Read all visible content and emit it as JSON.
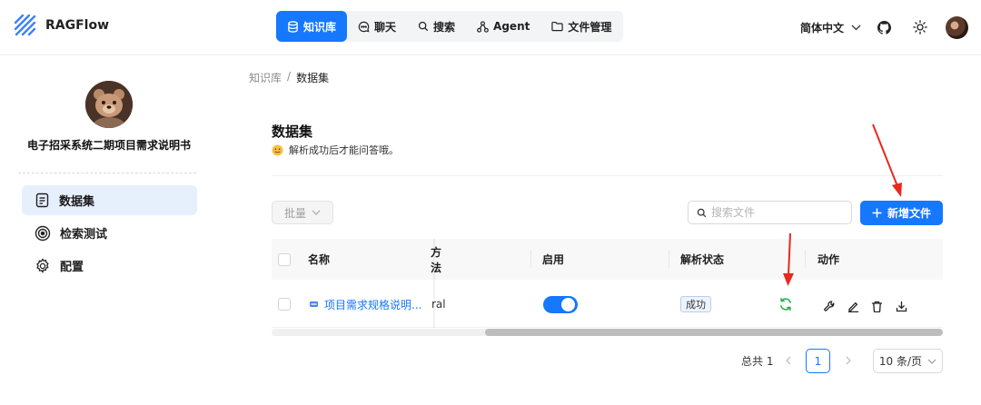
{
  "app": {
    "name": "RAGFlow"
  },
  "nav": {
    "items": [
      {
        "label": "知识库",
        "icon": "database-icon",
        "active": true
      },
      {
        "label": "聊天",
        "icon": "chat-icon"
      },
      {
        "label": "搜索",
        "icon": "search-icon"
      },
      {
        "label": "Agent",
        "icon": "agent-icon"
      },
      {
        "label": "文件管理",
        "icon": "folder-icon"
      }
    ]
  },
  "header": {
    "language": "简体中文"
  },
  "sidebar": {
    "kb_name": "电子招采系统二期项目需求说明书",
    "items": [
      {
        "label": "数据集",
        "icon": "document-icon",
        "active": true
      },
      {
        "label": "检索测试",
        "icon": "target-icon"
      },
      {
        "label": "配置",
        "icon": "gear-icon"
      }
    ]
  },
  "breadcrumb": {
    "root": "知识库",
    "separator": "/",
    "current": "数据集"
  },
  "main": {
    "title": "数据集",
    "subtitle": "解析成功后才能问答哦。",
    "bulk_label": "批量",
    "search_placeholder": "搜索文件",
    "add_label": "新增文件"
  },
  "table": {
    "columns": {
      "name": "名称",
      "method": "方法",
      "enabled": "启用",
      "status": "解析状态",
      "actions": "动作"
    },
    "rows": [
      {
        "name": "项目需求规格说明...",
        "method": "ral",
        "enabled": true,
        "status": "成功"
      }
    ]
  },
  "pagination": {
    "total": "总共 1",
    "current_page": "1",
    "page_size": "10 条/页"
  },
  "colors": {
    "primary": "#1677ff",
    "annotation": "#e8291c",
    "success": "#22b04b"
  }
}
